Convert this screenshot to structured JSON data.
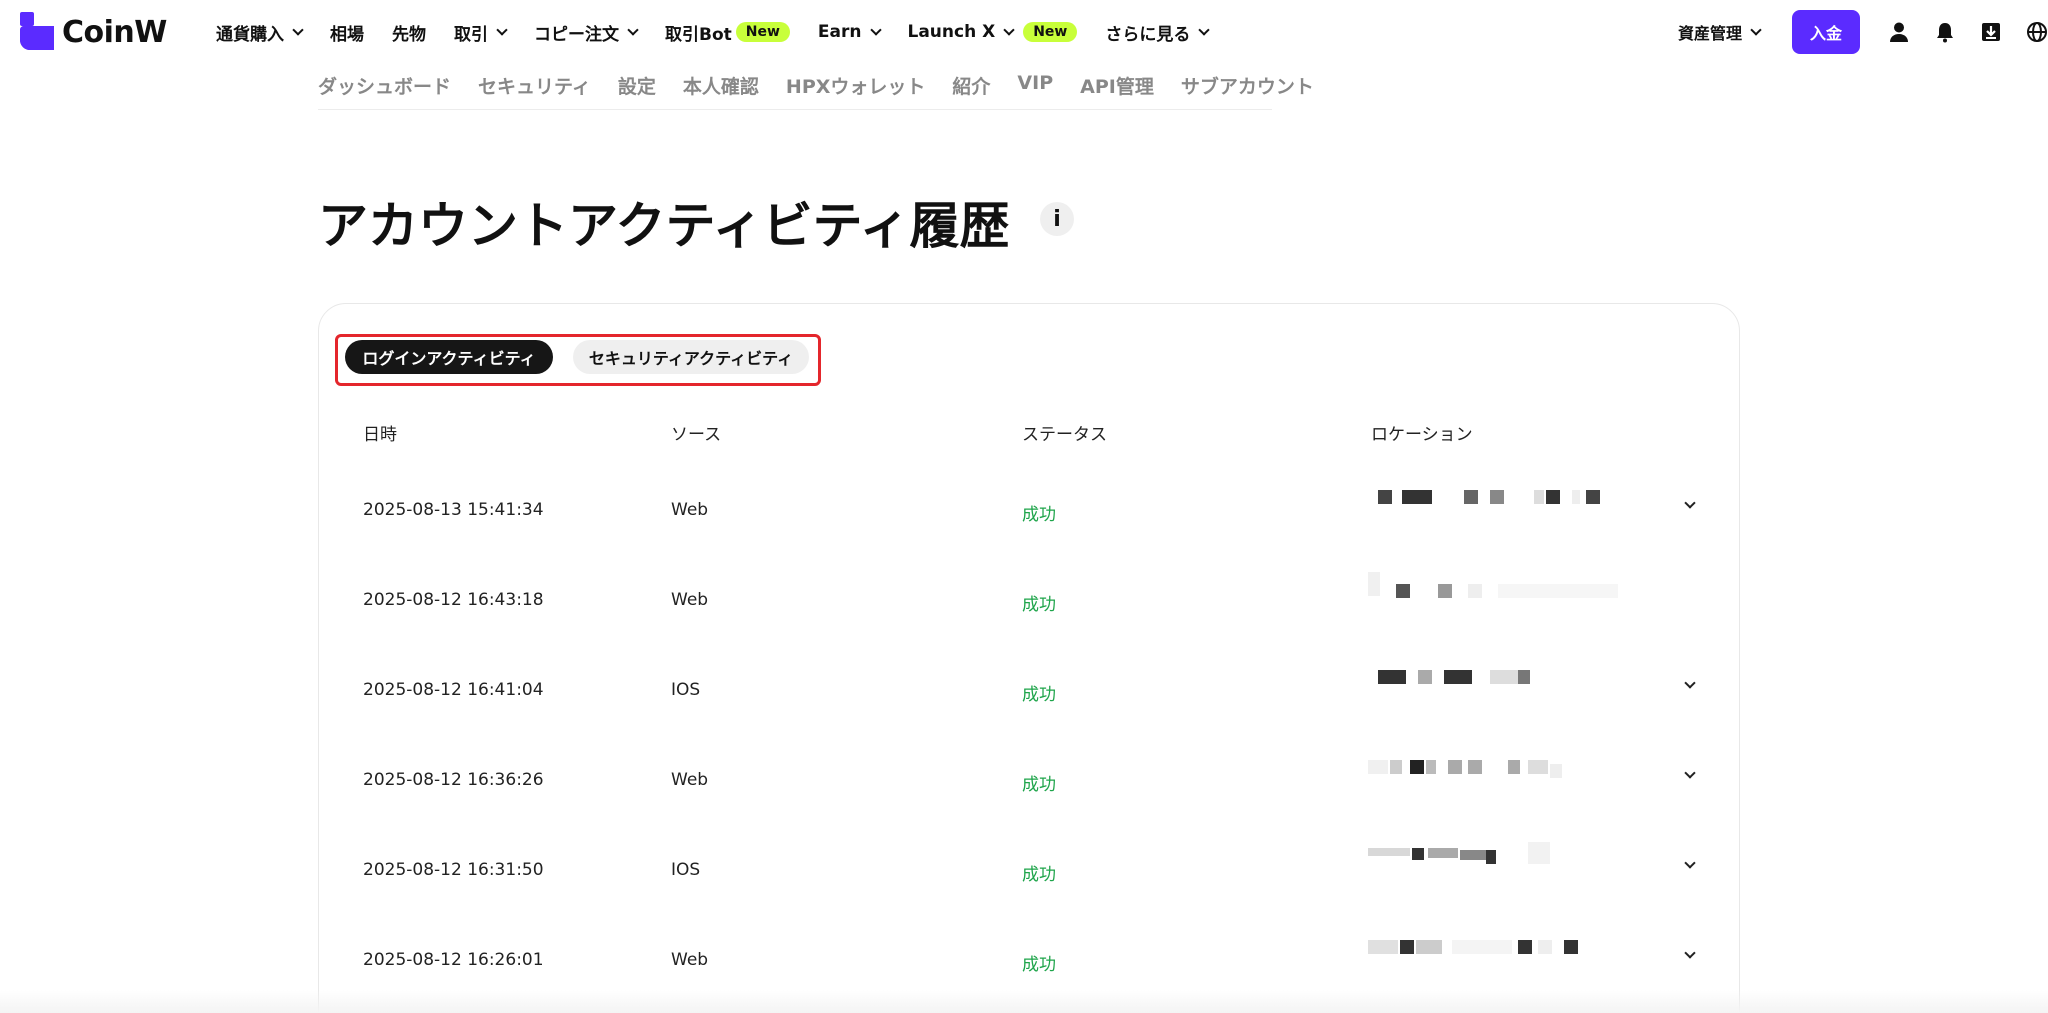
{
  "brand": {
    "name": "CoinW",
    "accent": "#5b2bff"
  },
  "nav": {
    "items": [
      {
        "label": "通貨購入",
        "has_dropdown": true
      },
      {
        "label": "相場",
        "has_dropdown": false
      },
      {
        "label": "先物",
        "has_dropdown": false
      },
      {
        "label": "取引",
        "has_dropdown": true
      },
      {
        "label": "コピー注文",
        "has_dropdown": true
      },
      {
        "label": "取引Bot",
        "badge": "New"
      },
      {
        "label": "Earn",
        "has_dropdown": true
      },
      {
        "label": "Launch X",
        "has_dropdown": true,
        "badge": "New"
      },
      {
        "label": "さらに見る",
        "has_dropdown": true
      }
    ],
    "asset_label": "資産管理",
    "deposit_label": "入金",
    "right_icons": [
      "user-icon",
      "bell-icon",
      "download-icon",
      "globe-icon"
    ]
  },
  "subnav": {
    "items": [
      "ダッシュボード",
      "セキュリティ",
      "設定",
      "本人確認",
      "HPXウォレット",
      "紹介",
      "VIP",
      "API管理",
      "サブアカウント"
    ]
  },
  "page": {
    "title": "アカウントアクティビティ履歴",
    "info_icon_label": "i"
  },
  "tabs": {
    "login": "ログインアクティビティ",
    "security": "セキュリティアクティビティ"
  },
  "table": {
    "headers": {
      "datetime": "日時",
      "source": "ソース",
      "status": "ステータス",
      "location": "ロケーション"
    },
    "rows": [
      {
        "datetime": "2025-08-13 15:41:34",
        "source": "Web",
        "status": "成功",
        "expandable": true
      },
      {
        "datetime": "2025-08-12 16:43:18",
        "source": "Web",
        "status": "成功",
        "expandable": false
      },
      {
        "datetime": "2025-08-12 16:41:04",
        "source": "IOS",
        "status": "成功",
        "expandable": true
      },
      {
        "datetime": "2025-08-12 16:36:26",
        "source": "Web",
        "status": "成功",
        "expandable": true
      },
      {
        "datetime": "2025-08-12 16:31:50",
        "source": "IOS",
        "status": "成功",
        "expandable": true
      },
      {
        "datetime": "2025-08-12 16:26:01",
        "source": "Web",
        "status": "成功",
        "expandable": true
      }
    ]
  },
  "colors": {
    "success": "#1ea44a",
    "highlight_frame": "#e4262c",
    "new_badge": "#c8ff3a"
  }
}
